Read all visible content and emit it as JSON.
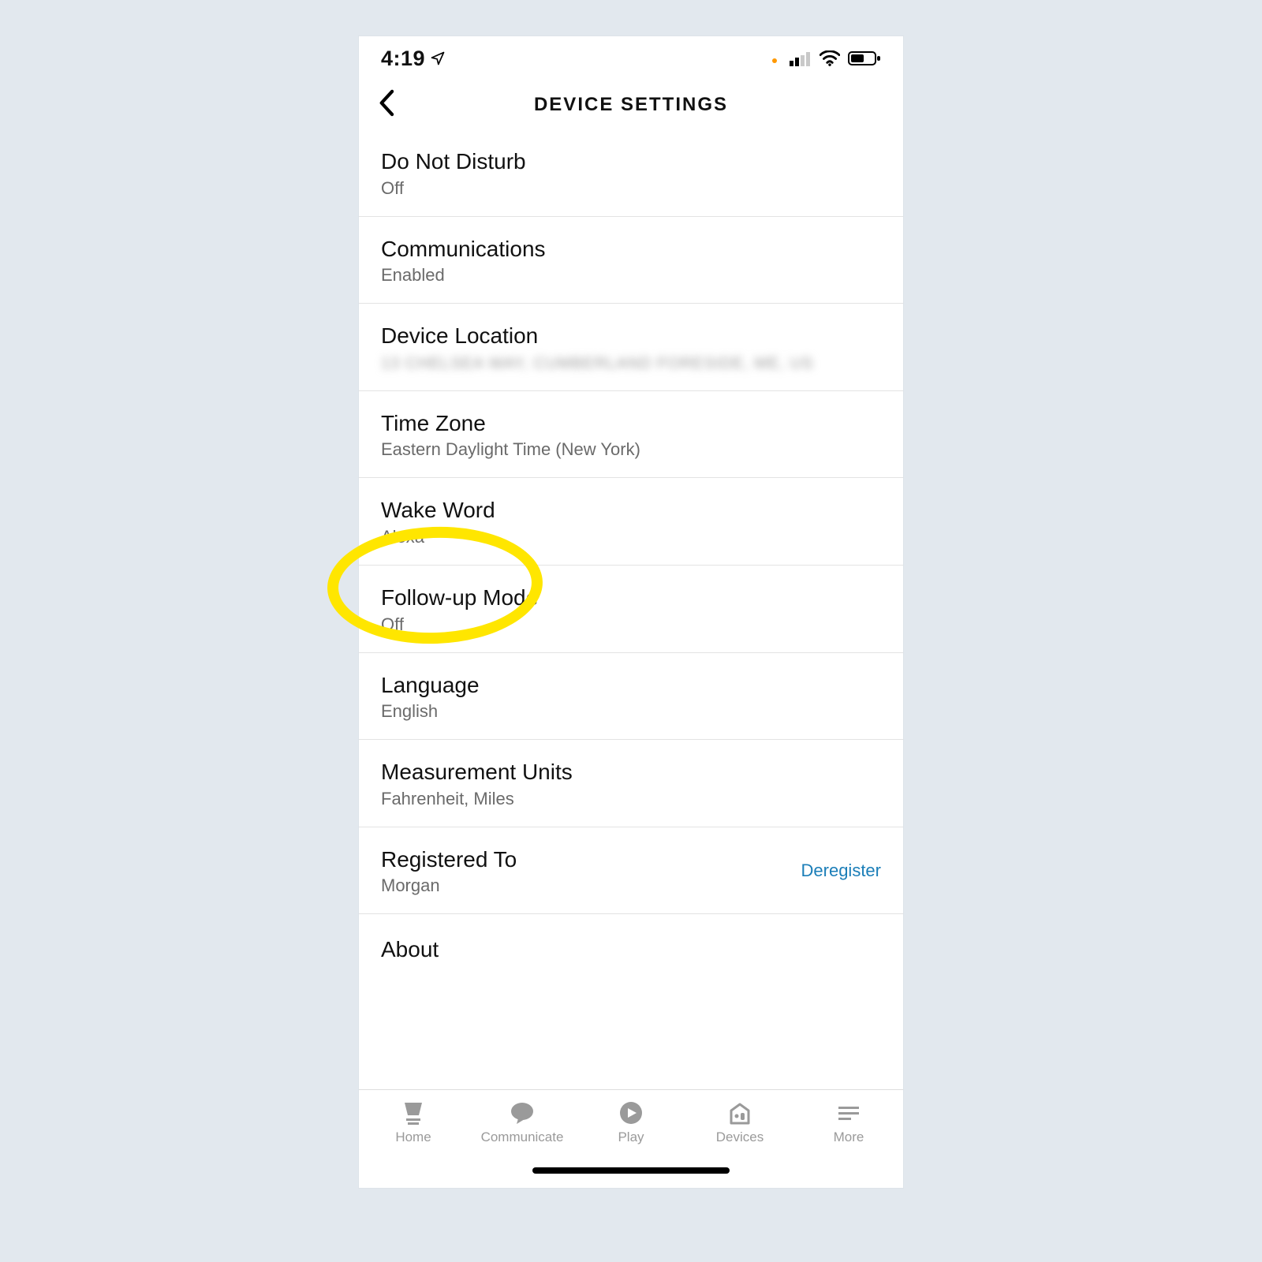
{
  "statusbar": {
    "time": "4:19"
  },
  "header": {
    "title": "DEVICE SETTINGS"
  },
  "settings": {
    "dnd": {
      "label": "Do Not Disturb",
      "value": "Off"
    },
    "comm": {
      "label": "Communications",
      "value": "Enabled"
    },
    "location": {
      "label": "Device Location",
      "value": "13 Chelsea Way, Cumberland Foreside, ME, US"
    },
    "timezone": {
      "label": "Time Zone",
      "value": "Eastern Daylight Time (New York)"
    },
    "wakeword": {
      "label": "Wake Word",
      "value": "Alexa"
    },
    "followup": {
      "label": "Follow-up Mode",
      "value": "Off"
    },
    "language": {
      "label": "Language",
      "value": "English"
    },
    "units": {
      "label": "Measurement Units",
      "value": "Fahrenheit, Miles"
    },
    "registered": {
      "label": "Registered To",
      "value": "Morgan",
      "action": "Deregister"
    },
    "about": {
      "label": "About"
    }
  },
  "tabs": {
    "home": "Home",
    "communicate": "Communicate",
    "play": "Play",
    "devices": "Devices",
    "more": "More"
  },
  "annotation": {
    "highlight_target": "wakeword"
  }
}
